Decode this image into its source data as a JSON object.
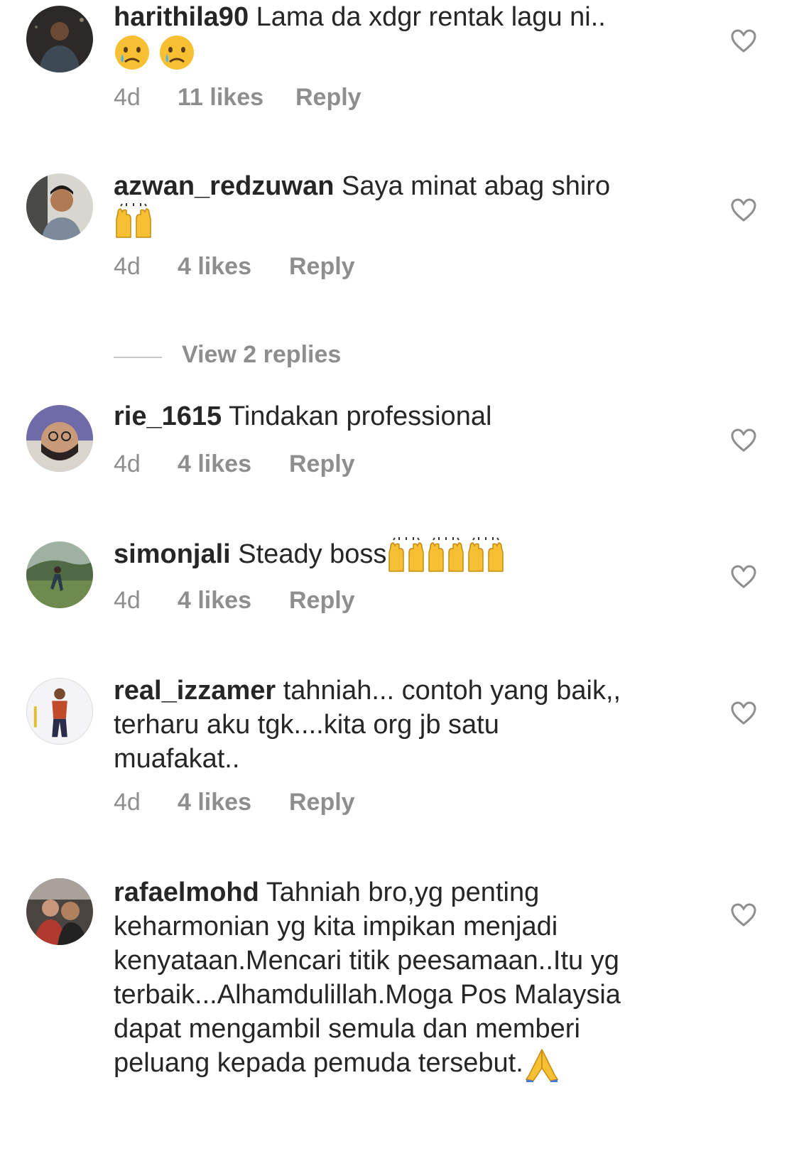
{
  "comments": [
    {
      "username": "harithila90",
      "text": "Lama da xdgr rentak lagu ni..",
      "emoji": [
        "crying-face",
        "crying-face"
      ],
      "time": "4d",
      "likes": "11 likes",
      "reply": "Reply"
    },
    {
      "username": "azwan_redzuwan",
      "text": "Saya minat abag shiro",
      "emoji": [
        "raising-hands"
      ],
      "time": "4d",
      "likes": "4 likes",
      "reply": "Reply"
    },
    {
      "username": "rie_1615",
      "text": "Tindakan professional",
      "emoji": [],
      "time": "4d",
      "likes": "4 likes",
      "reply": "Reply"
    },
    {
      "username": "simonjali",
      "text": "Steady boss",
      "emoji": [
        "raising-hands",
        "raising-hands",
        "raising-hands"
      ],
      "time": "4d",
      "likes": "4 likes",
      "reply": "Reply"
    },
    {
      "username": "real_izzamer",
      "text": "tahniah... contoh yang baik,, terharu aku tgk....kita org jb satu muafakat..",
      "emoji": [],
      "time": "4d",
      "likes": "4 likes",
      "reply": "Reply"
    },
    {
      "username": "rafaelmohd",
      "text": "Tahniah bro,yg penting keharmonian yg kita impikan menjadi kenyataan.Mencari titik peesamaan..Itu yg terbaik...Alhamdulillah.Moga Pos Malaysia dapat mengambil semula dan memberi peluang kepada pemuda tersebut.",
      "emoji": [
        "folded-hands"
      ],
      "time": "",
      "likes": "",
      "reply": ""
    }
  ],
  "view_replies": "View 2 replies",
  "colors": {
    "text": "#262626",
    "meta": "#8e8e8e",
    "divider": "#c7c7c7",
    "emoji_yellow": "#f7c033"
  }
}
